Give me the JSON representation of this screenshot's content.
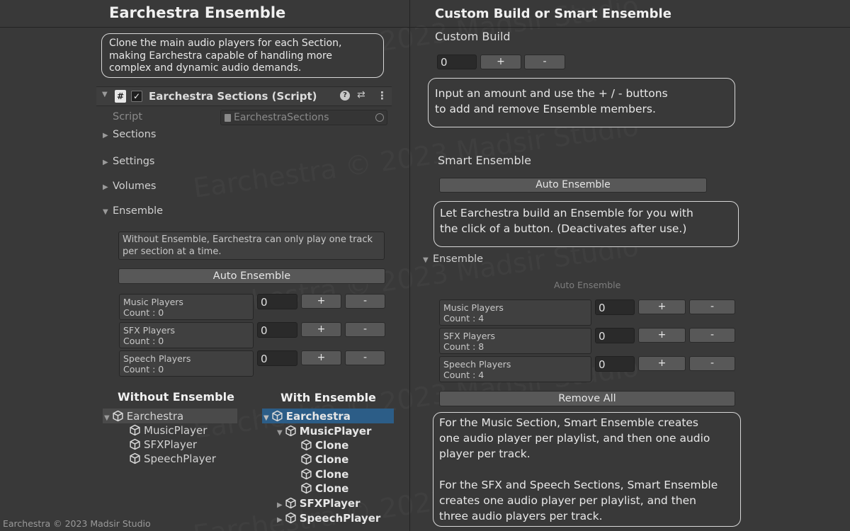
{
  "left": {
    "title": "Earchestra Ensemble",
    "intro": [
      "Clone the main audio players for each Section,",
      "making Earchestra capable of handling more",
      "complex and dynamic audio demands."
    ],
    "component": {
      "title": "Earchestra Sections (Script)",
      "script_label": "Script",
      "script_value": "EarchestraSections"
    },
    "foldouts": [
      "Sections",
      "Settings",
      "Volumes",
      "Ensemble"
    ],
    "ensemble_help": [
      "Without Ensemble, Earchestra can only play one track",
      "per section at a time."
    ],
    "auto_button": "Auto Ensemble",
    "players": [
      {
        "name": "Music Players",
        "count": "Count : 0",
        "value": "0"
      },
      {
        "name": "SFX Players",
        "count": "Count : 0",
        "value": "0"
      },
      {
        "name": "Speech Players",
        "count": "Count : 0",
        "value": "0"
      }
    ],
    "plus": "+",
    "minus": "-",
    "without_heading": "Without Ensemble",
    "with_heading": "With Ensemble",
    "tree_without": [
      "Earchestra",
      "MusicPlayer",
      "SFXPlayer",
      "SpeechPlayer"
    ],
    "tree_with": [
      "Earchestra",
      "MusicPlayer",
      "Clone",
      "Clone",
      "Clone",
      "Clone",
      "SFXPlayer",
      "SpeechPlayer"
    ]
  },
  "right": {
    "title": "Custom Build or Smart Ensemble",
    "custom_heading": "Custom Build",
    "custom_value": "0",
    "custom_help": [
      "Input an amount and use the + / - buttons",
      "to add and remove Ensemble members."
    ],
    "smart_heading": "Smart Ensemble",
    "auto_button": "Auto Ensemble",
    "smart_help": [
      "Let Earchestra build an Ensemble for you with",
      "the click of a button. (Deactivates after use.)"
    ],
    "foldout": "Ensemble",
    "auto_disabled": "Auto Ensemble",
    "players": [
      {
        "name": "Music Players",
        "count": "Count : 4",
        "value": "0"
      },
      {
        "name": "SFX Players",
        "count": "Count : 8",
        "value": "0"
      },
      {
        "name": "Speech Players",
        "count": "Count : 4",
        "value": "0"
      }
    ],
    "remove_all": "Remove All",
    "explain_1": [
      "For the Music Section, Smart Ensemble creates",
      "one audio player per playlist, and then one audio",
      "player per track."
    ],
    "explain_2": [
      "For the SFX and Speech Sections, Smart Ensemble",
      "creates one audio player per playlist, and then",
      "three audio players per track."
    ]
  },
  "footer": "Earchestra © 2023 Madsir Studio",
  "watermark": "Earchestra © 2023 Madsir Studio"
}
